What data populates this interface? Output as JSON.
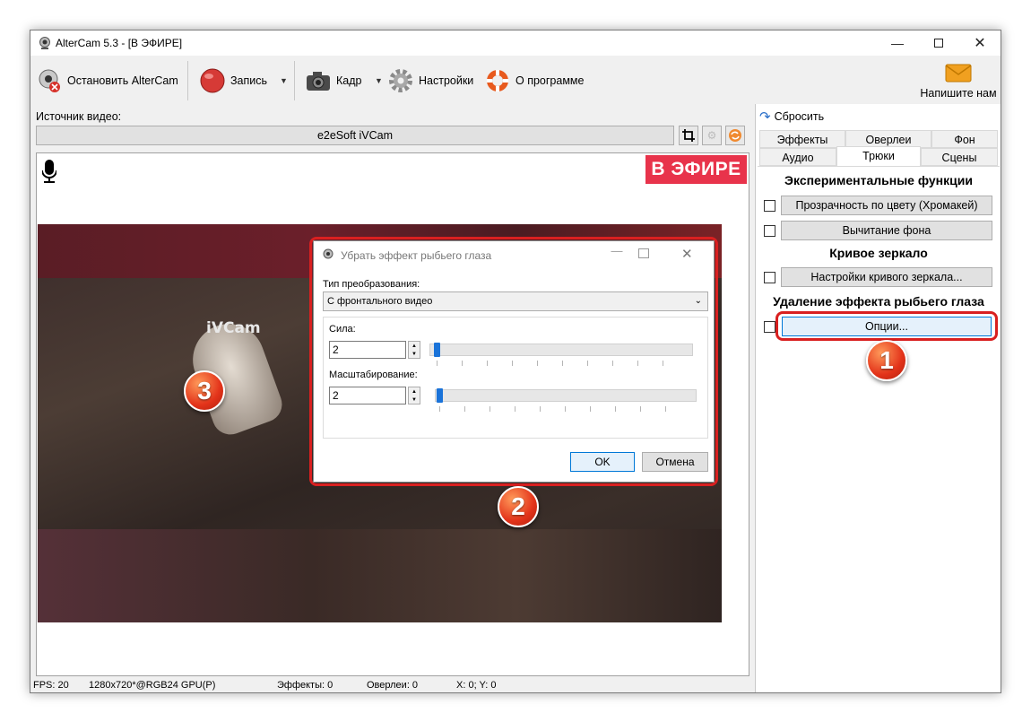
{
  "window": {
    "title": "AlterCam 5.3 - [В ЭФИРЕ]"
  },
  "toolbar": {
    "stop_label": "Остановить AlterCam",
    "record_label": "Запись",
    "frame_label": "Кадр",
    "settings_label": "Настройки",
    "about_label": "О программе",
    "mail_label": "Напишите нам"
  },
  "source": {
    "label": "Источник видео:",
    "value": "e2eSoft iVCam"
  },
  "video": {
    "on_air": "В ЭФИРЕ",
    "watermark": "iVCam"
  },
  "status": {
    "fps": "FPS: 20",
    "format": "1280x720*@RGB24 GPU(P)",
    "effects": "Эффекты: 0",
    "overlays": "Оверлеи: 0",
    "coords": "X: 0; Y: 0"
  },
  "panel": {
    "reset_label": "Сбросить",
    "tabs_row1": [
      "Эффекты",
      "Оверлеи",
      "Фон"
    ],
    "tabs_row2": [
      "Аудио",
      "Трюки",
      "Сцены"
    ],
    "active_tab": "Трюки",
    "section_experimental": "Экспериментальные функции",
    "chroma_btn": "Прозрачность по цвету (Хромакей)",
    "bg_subtract_btn": "Вычитание фона",
    "section_mirror": "Кривое зеркало",
    "mirror_btn": "Настройки кривого зеркала...",
    "section_fisheye": "Удаление эффекта рыбьего глаза",
    "options_btn": "Опции..."
  },
  "dialog": {
    "title": "Убрать эффект рыбьего глаза",
    "type_label": "Тип преобразования:",
    "type_value": "С фронтального видео",
    "strength_label": "Сила:",
    "strength_value": "2",
    "scale_label": "Масштабирование:",
    "scale_value": "2",
    "ok": "OK",
    "cancel": "Отмена"
  },
  "badges": [
    "1",
    "2",
    "3"
  ],
  "colors": {
    "on_air_bg": "#e8334b",
    "highlight": "#d92020",
    "slider_thumb": "#1a73d9"
  }
}
